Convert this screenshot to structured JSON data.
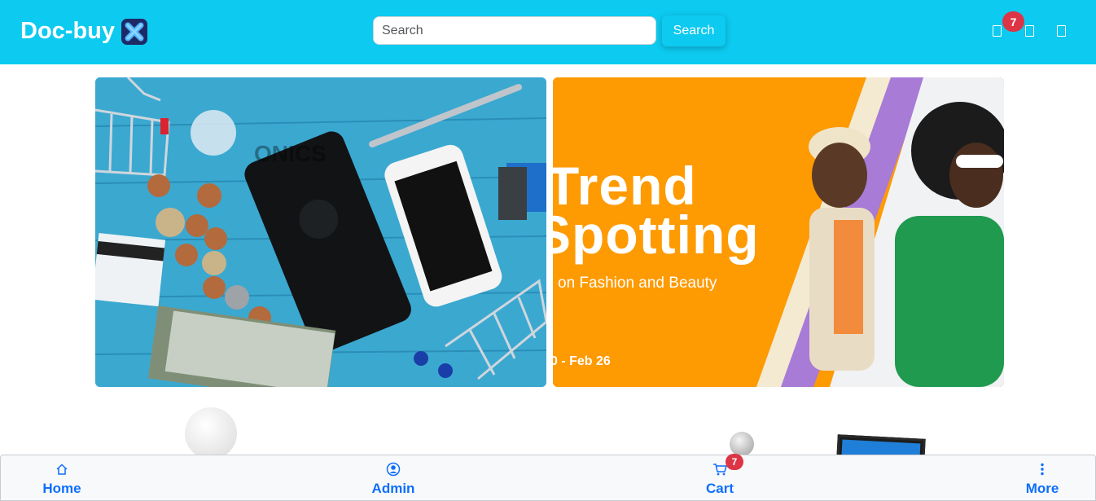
{
  "header": {
    "brand": "Doc-buy",
    "search": {
      "placeholder": "Search",
      "value": ""
    },
    "search_button": "Search",
    "icons": [
      "cart-icon",
      "user-icon",
      "menu-icon"
    ],
    "cart_count": "7"
  },
  "carousel": {
    "left_banner": {
      "faded_text": "ONICS"
    },
    "right_banner": {
      "headline_line1": "Trend",
      "headline_line2": "Spotting",
      "subline": "on Fashion and Beauty",
      "date": "0 - Feb 26"
    }
  },
  "bottom_nav": {
    "items": [
      {
        "label": "Home",
        "icon": "home-icon"
      },
      {
        "label": "Admin",
        "icon": "user-circle-icon"
      },
      {
        "label": "Cart",
        "icon": "cart-icon"
      },
      {
        "label": "More",
        "icon": "more-vertical-icon"
      }
    ],
    "cart_badge": "7"
  },
  "colors": {
    "topbar": "#0dcaf0",
    "badge": "#dc3545",
    "bottom_nav_text": "#0d6efd",
    "right_banner": "#fe9a02"
  }
}
